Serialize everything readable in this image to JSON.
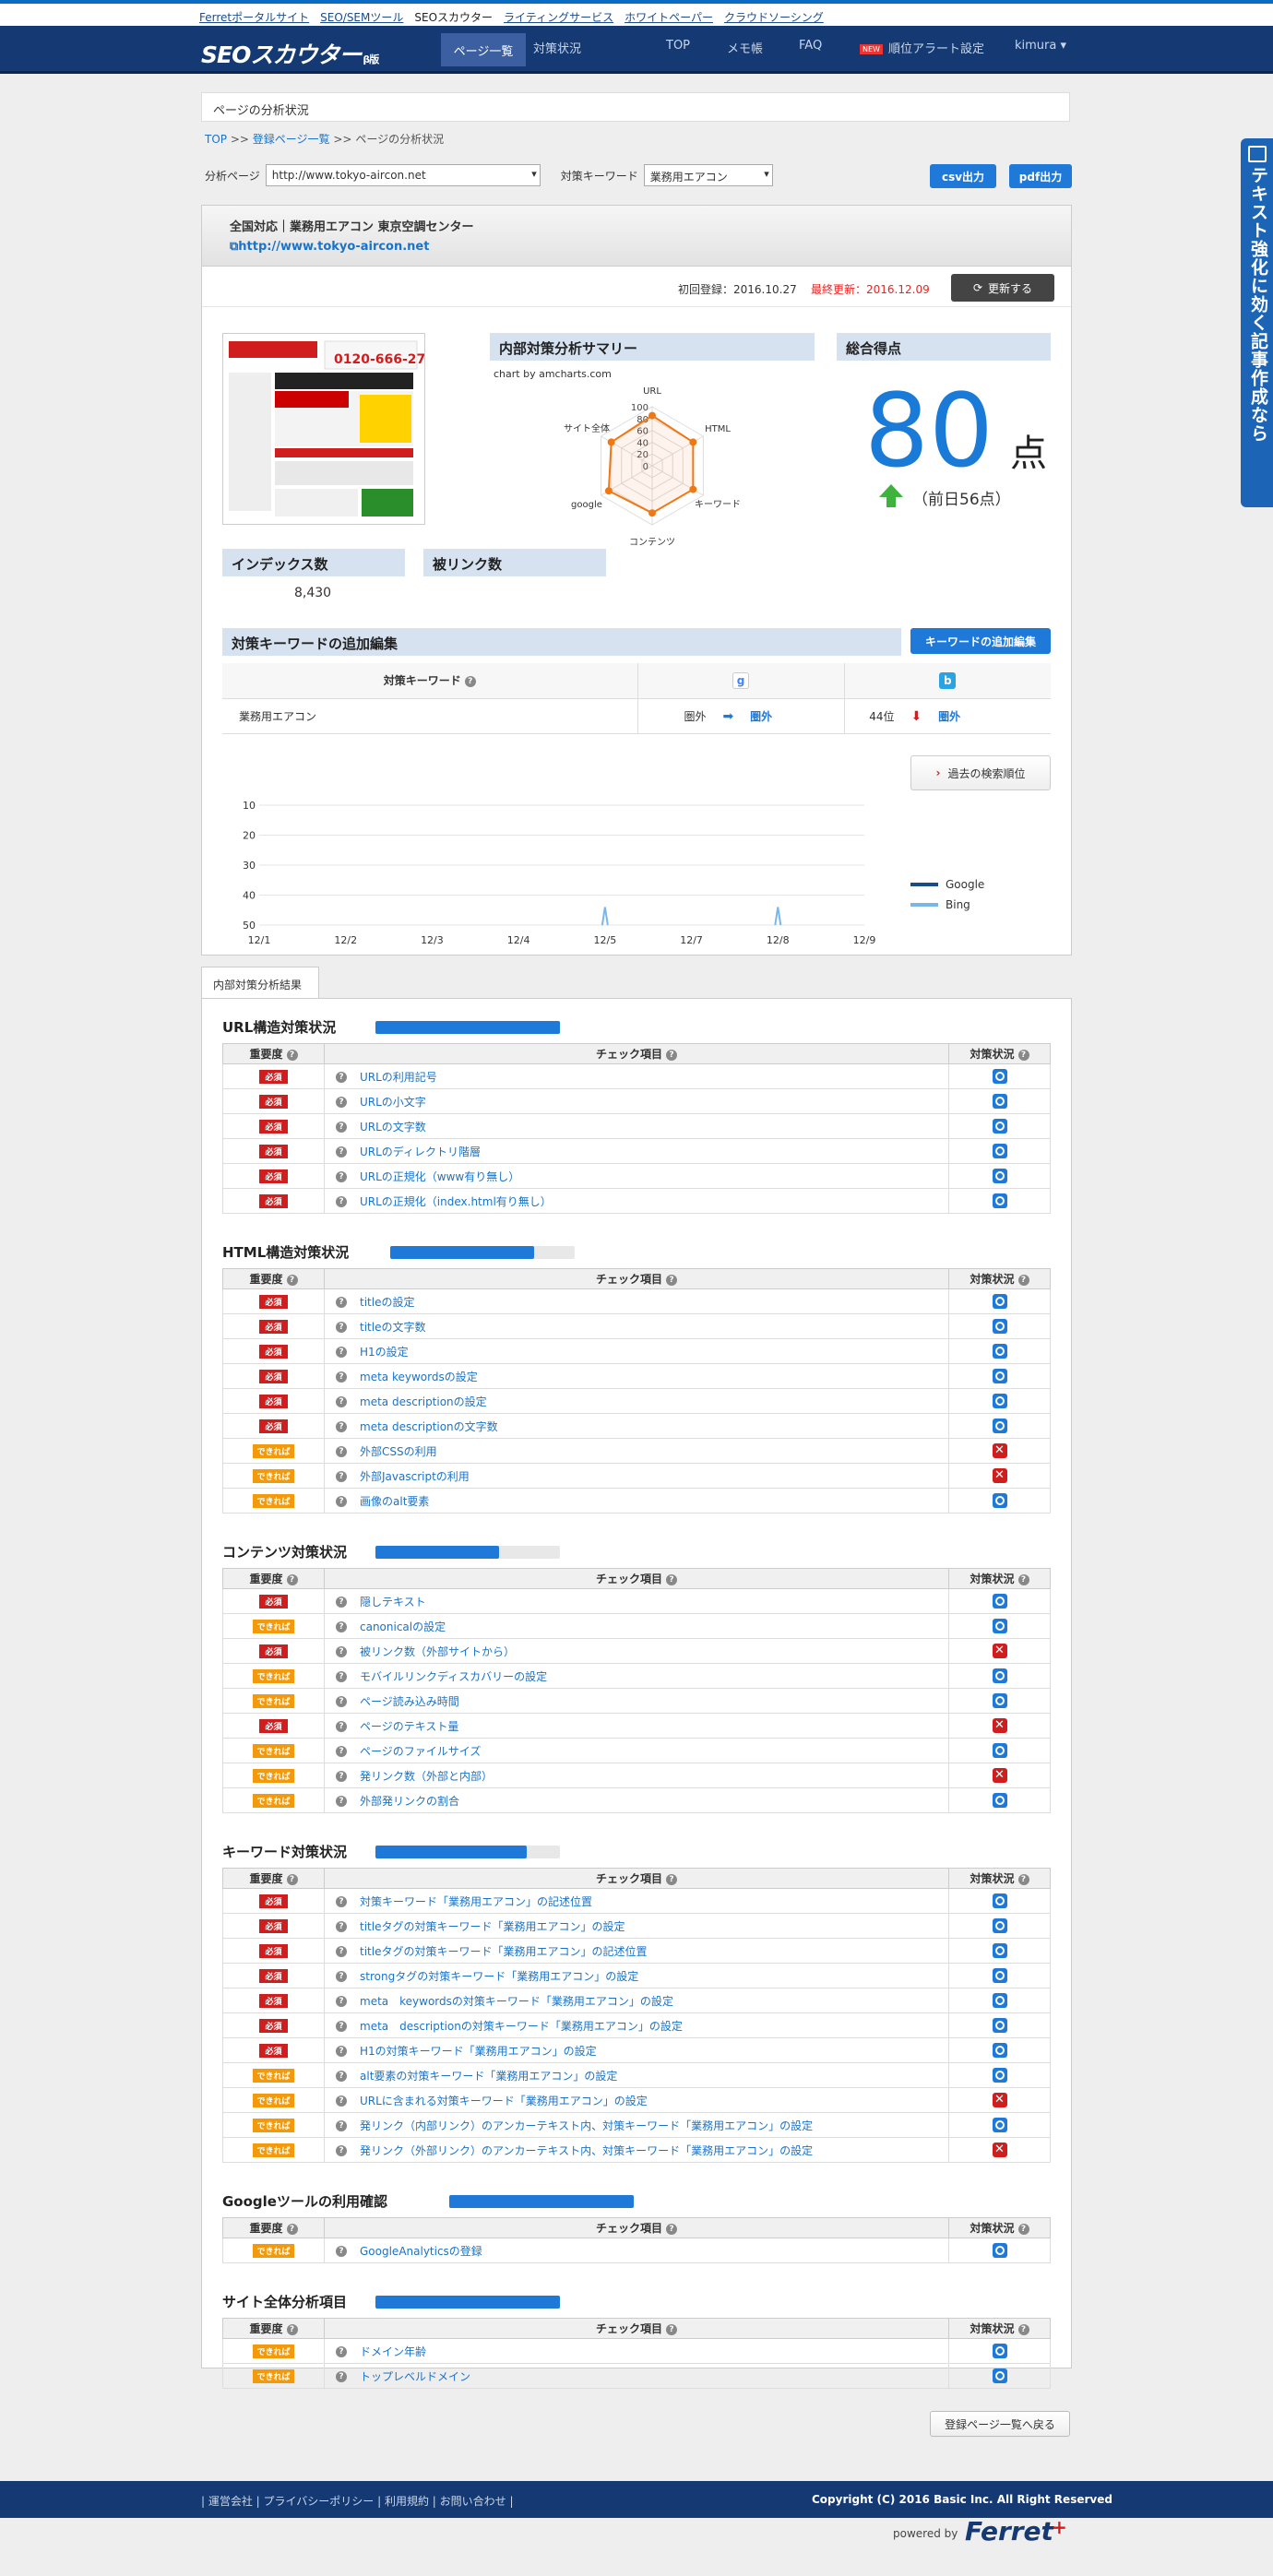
{
  "toplinks": [
    {
      "label": "Ferretポータルサイト",
      "current": false
    },
    {
      "label": "SEO/SEMツール",
      "current": false
    },
    {
      "label": "SEOスカウター",
      "current": true
    },
    {
      "label": "ライティングサービス",
      "current": false
    },
    {
      "label": "ホワイトペーパー",
      "current": false
    },
    {
      "label": "クラウドソーシング",
      "current": false
    }
  ],
  "nav": {
    "logo": "SEOスカウター",
    "logo_beta": "β版",
    "active_tab": "ページ一覧",
    "tab2": "対策状況",
    "top": "TOP",
    "memo": "メモ帳",
    "faq": "FAQ",
    "new_badge": "NEW",
    "alert": "順位アラート設定",
    "user": "kimura"
  },
  "side_tab": "テキスト強化に効く記事作成なら",
  "page_title": "ページの分析状況",
  "breadcrumb": {
    "top": "TOP",
    "list": "登録ページ一覧",
    "current": "ページの分析状況",
    "sep": ">>"
  },
  "filter": {
    "page_label": "分析ページ",
    "page_value": "http://www.tokyo-aircon.net",
    "kw_label": "対策キーワード",
    "kw_value": "業務用エアコン",
    "csv": "csv出力",
    "pdf": "pdf出力"
  },
  "site": {
    "name": "全国対応｜業務用エアコン 東京空調センター",
    "url": "http://www.tokyo-aircon.net"
  },
  "dates": {
    "first": "初回登録：2016.10.27",
    "last": "最終更新：2016.12.09",
    "update_button": "更新する"
  },
  "summary": {
    "title": "内部対策分析サマリー",
    "caption": "chart by amcharts.com",
    "radar_axes": [
      "URL",
      "HTML",
      "キーワード",
      "コンテンツ",
      "google",
      "サイト全体"
    ],
    "radar_ticks": [
      "100",
      "80",
      "60",
      "40",
      "20",
      "0"
    ]
  },
  "score": {
    "title": "総合得点",
    "value": "80",
    "unit": "点",
    "prev": "（前日56点）"
  },
  "index": {
    "title": "インデックス数",
    "value": "8,430"
  },
  "backlinks": {
    "title": "被リンク数"
  },
  "keywords": {
    "title": "対策キーワードの追加編集",
    "button": "キーワードの追加編集",
    "col_header": "対策キーワード",
    "rows": [
      {
        "keyword": "業務用エアコン",
        "google_prev": "圏外",
        "google_now": "圏外",
        "bing_prev": "44位",
        "bing_now": "圏外"
      }
    ],
    "past_button": "過去の検索順位"
  },
  "chart_data": {
    "type": "line",
    "categories": [
      "12/1",
      "12/2",
      "12/3",
      "12/4",
      "12/5",
      "12/7",
      "12/8",
      "12/9"
    ],
    "y_ticks": [
      "10",
      "20",
      "30",
      "40",
      "50"
    ],
    "ylim": [
      50,
      10
    ],
    "series": [
      {
        "name": "Google",
        "color": "#1a4c8c",
        "values": [
          null,
          null,
          null,
          null,
          null,
          null,
          null,
          null
        ]
      },
      {
        "name": "Bing",
        "color": "#7ab6e8",
        "values": [
          null,
          null,
          null,
          null,
          44,
          null,
          44,
          null
        ]
      }
    ]
  },
  "results_tab": "内部対策分析結果",
  "headers": {
    "imp": "重要度",
    "item": "チェック項目",
    "status": "対策状況"
  },
  "badges": {
    "req": "必須",
    "opt": "できれば"
  },
  "sections": [
    {
      "title": "URL構造対策状況",
      "progress": 1.0,
      "rows": [
        {
          "imp": "req",
          "label": "URLの利用記号",
          "ok": true
        },
        {
          "imp": "req",
          "label": "URLの小文字",
          "ok": true
        },
        {
          "imp": "req",
          "label": "URLの文字数",
          "ok": true
        },
        {
          "imp": "req",
          "label": "URLのディレクトリ階層",
          "ok": true
        },
        {
          "imp": "req",
          "label": "URLの正規化（www有り無し）",
          "ok": true
        },
        {
          "imp": "req",
          "label": "URLの正規化（index.html有り無し）",
          "ok": true
        }
      ]
    },
    {
      "title": "HTML構造対策状況",
      "progress": 0.78,
      "rows": [
        {
          "imp": "req",
          "label": "titleの設定",
          "ok": true
        },
        {
          "imp": "req",
          "label": "titleの文字数",
          "ok": true
        },
        {
          "imp": "req",
          "label": "H1の設定",
          "ok": true
        },
        {
          "imp": "req",
          "label": "meta keywordsの設定",
          "ok": true
        },
        {
          "imp": "req",
          "label": "meta descriptionの設定",
          "ok": true
        },
        {
          "imp": "req",
          "label": "meta descriptionの文字数",
          "ok": true
        },
        {
          "imp": "opt",
          "label": "外部CSSの利用",
          "ok": false
        },
        {
          "imp": "opt",
          "label": "外部Javascriptの利用",
          "ok": false
        },
        {
          "imp": "opt",
          "label": "画像のalt要素",
          "ok": true
        }
      ]
    },
    {
      "title": "コンテンツ対策状況",
      "progress": 0.67,
      "rows": [
        {
          "imp": "req",
          "label": "隠しテキスト",
          "ok": true
        },
        {
          "imp": "opt",
          "label": "canonicalの設定",
          "ok": true
        },
        {
          "imp": "req",
          "label": "被リンク数（外部サイトから）",
          "ok": false
        },
        {
          "imp": "opt",
          "label": "モバイルリンクディスカバリーの設定",
          "ok": true
        },
        {
          "imp": "opt",
          "label": "ページ読み込み時間",
          "ok": true
        },
        {
          "imp": "req",
          "label": "ページのテキスト量",
          "ok": false
        },
        {
          "imp": "opt",
          "label": "ページのファイルサイズ",
          "ok": true
        },
        {
          "imp": "opt",
          "label": "発リンク数（外部と内部）",
          "ok": false
        },
        {
          "imp": "opt",
          "label": "外部発リンクの割合",
          "ok": true
        }
      ]
    },
    {
      "title": "キーワード対策状況",
      "progress": 0.82,
      "rows": [
        {
          "imp": "req",
          "label": "対策キーワード「業務用エアコン」の記述位置",
          "ok": true
        },
        {
          "imp": "req",
          "label": "titleタグの対策キーワード「業務用エアコン」の設定",
          "ok": true
        },
        {
          "imp": "req",
          "label": "titleタグの対策キーワード「業務用エアコン」の記述位置",
          "ok": true
        },
        {
          "imp": "req",
          "label": "strongタグの対策キーワード「業務用エアコン」の設定",
          "ok": true
        },
        {
          "imp": "req",
          "label": "meta　keywordsの対策キーワード「業務用エアコン」の設定",
          "ok": true
        },
        {
          "imp": "req",
          "label": "meta　descriptionの対策キーワード「業務用エアコン」の設定",
          "ok": true
        },
        {
          "imp": "req",
          "label": "H1の対策キーワード「業務用エアコン」の設定",
          "ok": true
        },
        {
          "imp": "opt",
          "label": "alt要素の対策キーワード「業務用エアコン」の設定",
          "ok": true
        },
        {
          "imp": "opt",
          "label": "URLに含まれる対策キーワード「業務用エアコン」の設定",
          "ok": false
        },
        {
          "imp": "opt",
          "label": "発リンク（内部リンク）のアンカーテキスト内、対策キーワード「業務用エアコン」の設定",
          "ok": true
        },
        {
          "imp": "opt",
          "label": "発リンク（外部リンク）のアンカーテキスト内、対策キーワード「業務用エアコン」の設定",
          "ok": false
        }
      ]
    },
    {
      "title": "Googleツールの利用確認",
      "progress": 1.0,
      "rows": [
        {
          "imp": "opt",
          "label": "GoogleAnalyticsの登録",
          "ok": true
        }
      ]
    },
    {
      "title": "サイト全体分析項目",
      "progress": 1.0,
      "rows": [
        {
          "imp": "opt",
          "label": "ドメイン年齢",
          "ok": true
        },
        {
          "imp": "opt",
          "label": "トップレベルドメイン",
          "ok": true
        }
      ]
    }
  ],
  "back_button": "登録ページ一覧へ戻る",
  "footer": {
    "links": "| 運営会社 | プライバシーポリシー | 利用規約 | お問い合わせ |",
    "copyright": "Copyright (C) 2016 Basic Inc. All Right Reserved",
    "powered": "powered by",
    "ferret": "Ferret",
    "plus": "+"
  }
}
